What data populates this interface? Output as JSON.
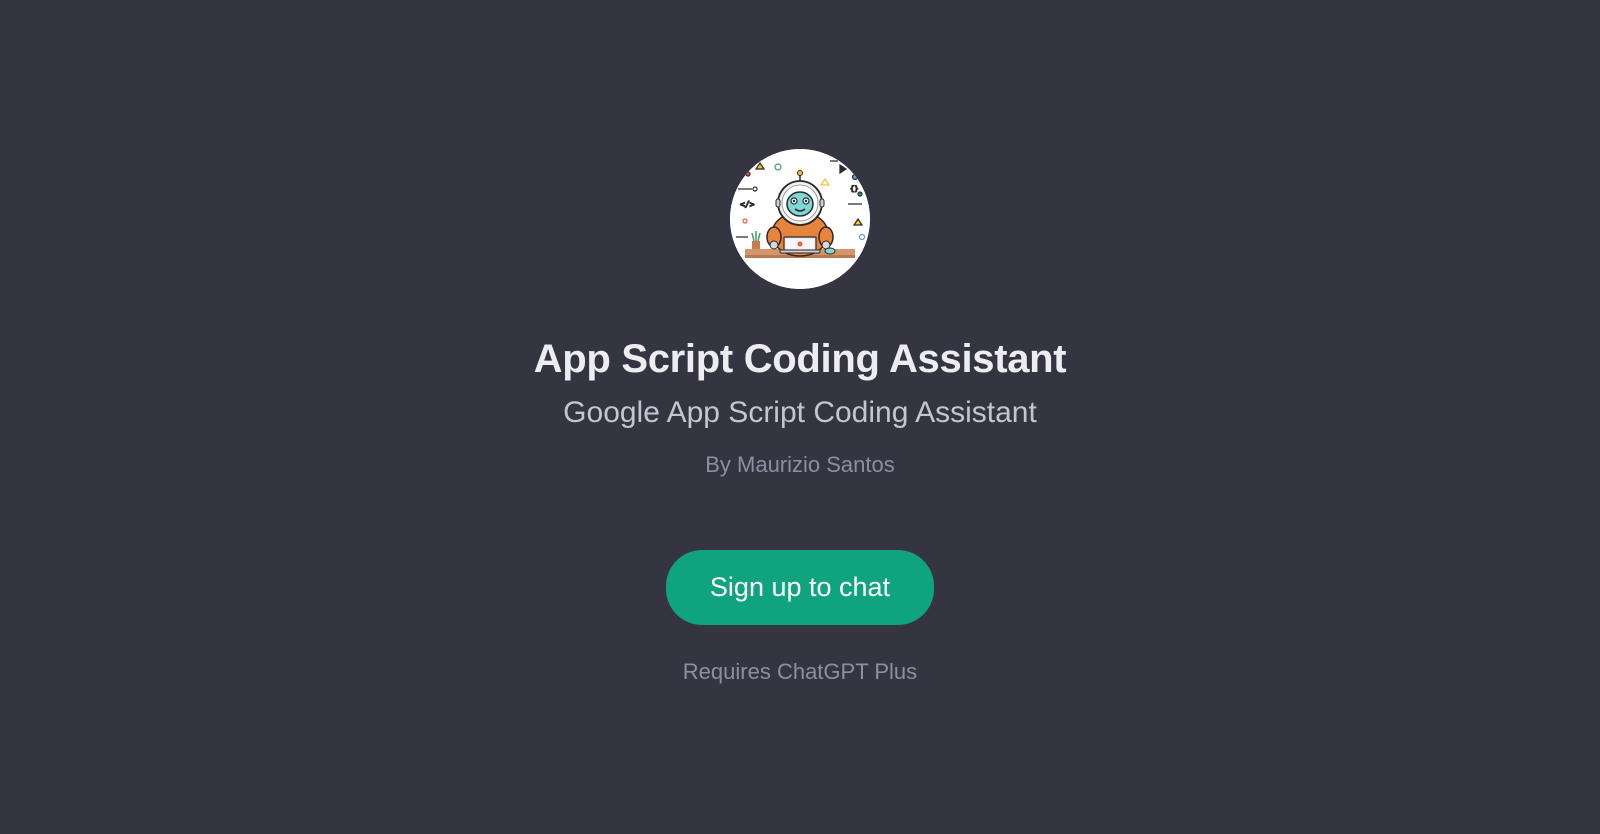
{
  "gpt": {
    "title": "App Script Coding Assistant",
    "subtitle": "Google App Script Coding Assistant",
    "author": "By Maurizio Santos",
    "avatar_alt": "robot-coding-avatar"
  },
  "actions": {
    "signup_label": "Sign up to chat",
    "requirement": "Requires ChatGPT Plus"
  }
}
